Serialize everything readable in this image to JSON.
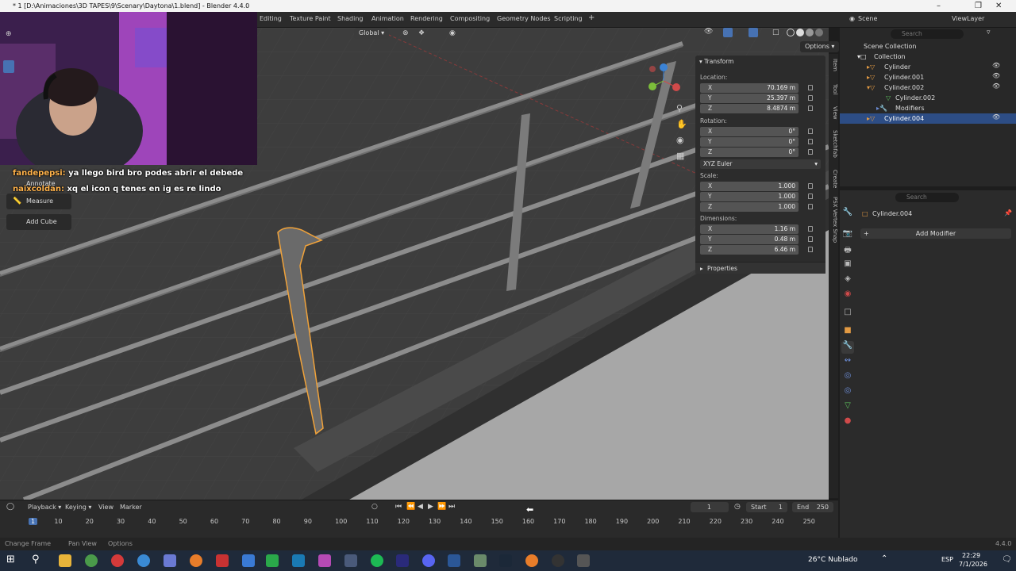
{
  "window": {
    "title": "* 1 [D:\\Animaciones\\3D TAPES\\9\\Scenary\\Daytona\\1.blend] - Blender 4.4.0"
  },
  "workspaces": [
    "Editing",
    "Texture Paint",
    "Shading",
    "Animation",
    "Rendering",
    "Compositing",
    "Geometry Nodes",
    "Scripting"
  ],
  "header": {
    "transform_space": "Global",
    "options": "Options",
    "scene": "Scene",
    "view_layer": "ViewLayer"
  },
  "chat": [
    {
      "user": "fandepepsi:",
      "msg": "ya llego bird bro podes abrir el debede"
    },
    {
      "user": "naixcoldan:",
      "msg": "xq el icon q tenes en ig es re lindo"
    }
  ],
  "tools": {
    "annotate": "Annotate",
    "measure": "Measure",
    "add_cube": "Add Cube"
  },
  "npanel": {
    "title": "Transform",
    "location_label": "Location:",
    "location": [
      {
        "axis": "X",
        "value": "70.169 m"
      },
      {
        "axis": "Y",
        "value": "25.397 m"
      },
      {
        "axis": "Z",
        "value": "8.4874 m"
      }
    ],
    "rotation_label": "Rotation:",
    "rotation": [
      {
        "axis": "X",
        "value": "0°"
      },
      {
        "axis": "Y",
        "value": "0°"
      },
      {
        "axis": "Z",
        "value": "0°"
      }
    ],
    "rotation_mode": "XYZ Euler",
    "scale_label": "Scale:",
    "scale": [
      {
        "axis": "X",
        "value": "1.000"
      },
      {
        "axis": "Y",
        "value": "1.000"
      },
      {
        "axis": "Z",
        "value": "1.000"
      }
    ],
    "dimensions_label": "Dimensions:",
    "dimensions": [
      {
        "axis": "X",
        "value": "1.16 m"
      },
      {
        "axis": "Y",
        "value": "0.48 m"
      },
      {
        "axis": "Z",
        "value": "6.46 m"
      }
    ],
    "properties": "Properties"
  },
  "side_tabs": [
    "Item",
    "Tool",
    "View",
    "Sketchfab",
    "Create",
    "PSX Vertex Snap"
  ],
  "outliner": {
    "search_placeholder": "Search",
    "rows": [
      "Scene Collection",
      "Collection",
      "Cylinder",
      "Cylinder.001",
      "Cylinder.002",
      "Cylinder.002",
      "Modifiers",
      "Cylinder.004"
    ]
  },
  "properties": {
    "search_placeholder": "Search",
    "object": "Cylinder.004",
    "add_modifier": "Add Modifier"
  },
  "timeline": {
    "menus": [
      "Playback",
      "Keying",
      "View",
      "Marker"
    ],
    "current_frame": "1",
    "start_label": "Start",
    "start": "1",
    "end_label": "End",
    "end": "250",
    "frames": [
      "1",
      "10",
      "20",
      "30",
      "40",
      "50",
      "60",
      "70",
      "80",
      "90",
      "100",
      "110",
      "120",
      "130",
      "140",
      "150",
      "160",
      "170",
      "180",
      "190",
      "200",
      "210",
      "220",
      "230",
      "240",
      "250"
    ]
  },
  "status": {
    "left": [
      "Change Frame",
      "Pan View",
      "Options"
    ],
    "version": "4.4.0"
  },
  "taskbar": {
    "weather": "26°C  Nublado",
    "lang": "ESP",
    "time": "22:29",
    "date": "7/1/2026"
  }
}
